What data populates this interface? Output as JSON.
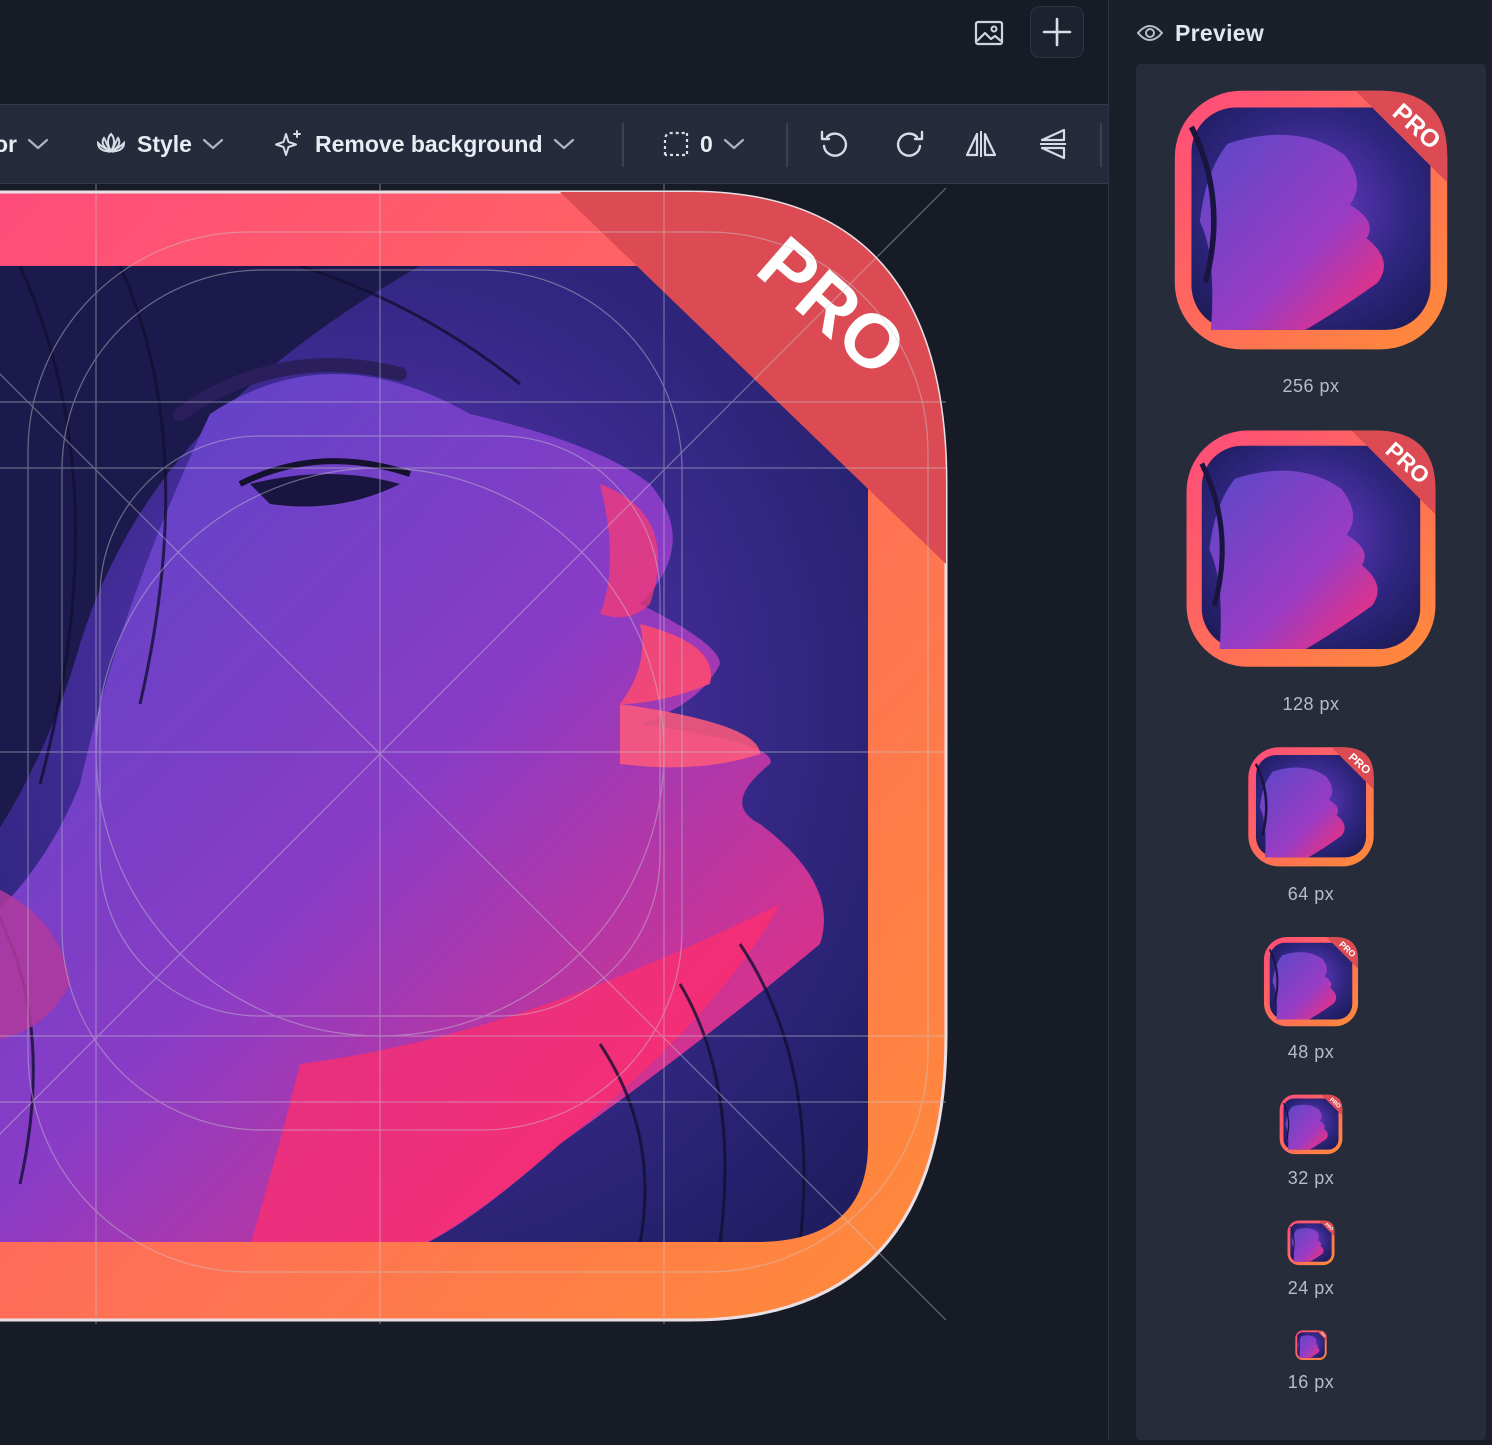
{
  "topbar": {
    "image_icon": "image-icon",
    "add_icon": "plus-icon"
  },
  "toolbar": {
    "partial_label": "or",
    "style_label": "Style",
    "remove_bg_label": "Remove background",
    "radius_value": "0",
    "icons": [
      "lotus-icon",
      "sparkles-icon",
      "corner-radius-icon",
      "undo-icon",
      "redo-icon",
      "flip-horizontal-icon",
      "flip-vertical-icon"
    ]
  },
  "canvas": {
    "badge_text": "PRO",
    "gradient_colors": [
      "#ff4e7a",
      "#ff8a3a"
    ],
    "badge_color": "#de4f55"
  },
  "preview": {
    "title": "Preview",
    "sizes": [
      {
        "label": "256 px"
      },
      {
        "label": "128 px"
      },
      {
        "label": "64 px"
      },
      {
        "label": "48 px"
      },
      {
        "label": "32 px"
      },
      {
        "label": "24 px"
      },
      {
        "label": "16 px"
      }
    ],
    "badge_text": "PRO"
  }
}
